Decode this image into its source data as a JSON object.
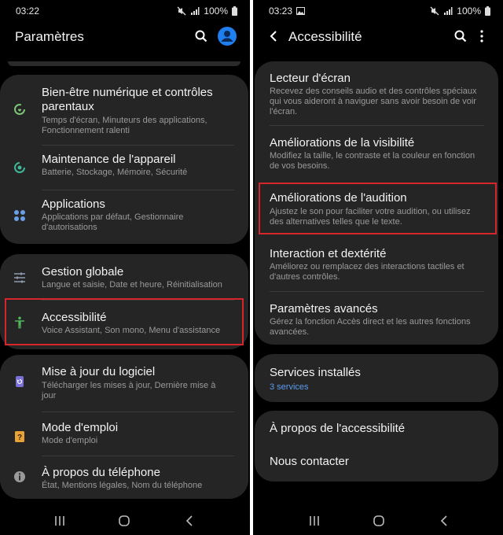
{
  "left": {
    "status": {
      "time": "03:22",
      "battery": "100%"
    },
    "header": {
      "title": "Paramètres"
    },
    "groups": [
      {
        "items": [
          {
            "title_line1": "Bien-être numérique et contrôles",
            "title_line2": "parentaux",
            "sub_line1": "Temps d'écran, Minuteurs des applications,",
            "sub_line2": "Fonctionnement ralenti",
            "icon": "digital-wellbeing-icon",
            "color": "#7cc576"
          },
          {
            "title_line1": "Maintenance de l'appareil",
            "sub_line1": "Batterie, Stockage, Mémoire, Sécurité",
            "icon": "device-care-icon",
            "color": "#3fb89a"
          },
          {
            "title_line1": "Applications",
            "sub_line1": "Applications par défaut, Gestionnaire",
            "sub_line2": "d'autorisations",
            "icon": "apps-icon",
            "color": "#6a9fe6"
          }
        ]
      },
      {
        "items": [
          {
            "title_line1": "Gestion globale",
            "sub_line1": "Langue et saisie, Date et heure, Réinitialisation",
            "icon": "sliders-icon",
            "color": "#8e9bb0"
          },
          {
            "title_line1": "Accessibilité",
            "sub_line1": "Voice Assistant, Son mono, Menu d'assistance",
            "icon": "accessibility-icon",
            "color": "#52b85c"
          }
        ]
      },
      {
        "items": [
          {
            "title_line1": "Mise à jour du logiciel",
            "sub_line1": "Télécharger les mises à jour, Dernière mise à",
            "sub_line2": "jour",
            "icon": "software-update-icon",
            "color": "#7b6fd8"
          },
          {
            "title_line1": "Mode d'emploi",
            "sub_line1": "Mode d'emploi",
            "icon": "user-manual-icon",
            "color": "#e8a23a"
          },
          {
            "title_line1": "À propos du téléphone",
            "sub_line1": "État, Mentions légales, Nom du téléphone",
            "icon": "info-icon",
            "color": "#9a9a9a"
          }
        ]
      }
    ]
  },
  "right": {
    "status": {
      "time": "03:23",
      "battery": "100%"
    },
    "header": {
      "title": "Accessibilité"
    },
    "groups": [
      {
        "items": [
          {
            "title": "Lecteur d'écran",
            "sub_line1": "Recevez des conseils audio et des contrôles spéciaux",
            "sub_line2": "qui vous aideront à naviguer sans avoir besoin de voir",
            "sub_line3": "l'écran."
          },
          {
            "title": "Améliorations de la visibilité",
            "sub_line1": "Modifiez la taille, le contraste et la couleur en fonction",
            "sub_line2": "de vos besoins."
          },
          {
            "title": "Améliorations de l'audition",
            "sub_line1": "Ajustez le son pour faciliter votre audition, ou utilisez",
            "sub_line2": "des alternatives telles que le texte."
          },
          {
            "title": "Interaction et dextérité",
            "sub_line1": "Améliorez ou remplacez des interactions tactiles et",
            "sub_line2": "d'autres contrôles."
          },
          {
            "title": "Paramètres avancés",
            "sub_line1": "Gérez la fonction Accès direct et les autres fonctions",
            "sub_line2": "avancées."
          }
        ]
      },
      {
        "items": [
          {
            "title": "Services installés",
            "sub_line1": "3 services"
          }
        ]
      },
      {
        "items": [
          {
            "title": "À propos de l'accessibilité"
          },
          {
            "title": "Nous contacter"
          }
        ]
      }
    ]
  },
  "colors": {
    "highlight": "#d7262b",
    "link": "#5b9cf0",
    "card": "#252525"
  }
}
